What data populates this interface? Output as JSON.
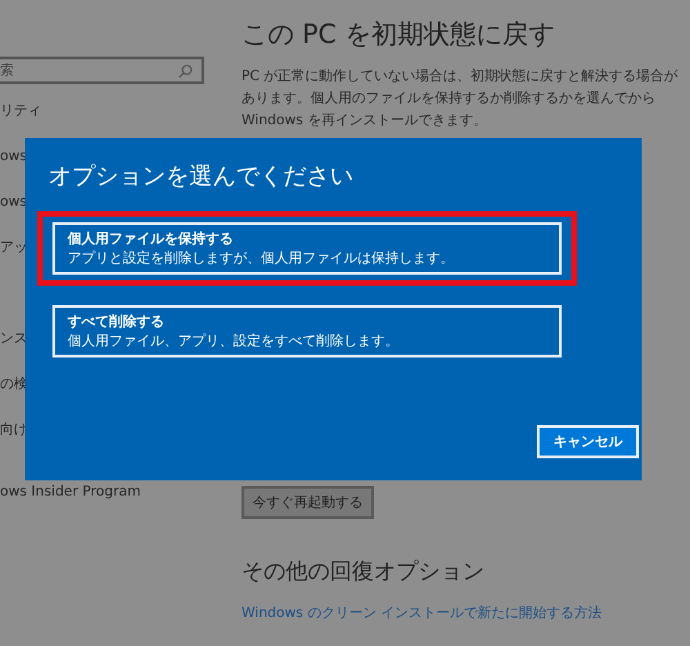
{
  "sidebar": {
    "search": {
      "placeholder": "索"
    },
    "items": [
      "リティ",
      "ows",
      "ows",
      "アッ",
      "ンス",
      "の検",
      "向け",
      "ows Insider Program"
    ]
  },
  "page": {
    "title": "この PC を初期状態に戻す",
    "description": "PC が正常に動作していない場合は、初期状態に戻すと解決する場合があります。個人用のファイルを保持するか削除するかを選んでから Windows を再インストールできます。",
    "restart_button": "今すぐ再起動する",
    "other_title": "その他の回復オプション",
    "link": "Windows のクリーン インストールで新たに開始する方法"
  },
  "dialog": {
    "title": "オプションを選んでください",
    "options": [
      {
        "title": "個人用ファイルを保持する",
        "description": "アプリと設定を削除しますが、個人用ファイルは保持します。",
        "highlighted": true
      },
      {
        "title": "すべて削除する",
        "description": "個人用ファイル、アプリ、設定をすべて削除します。",
        "highlighted": false
      }
    ],
    "cancel_button": "キャンセル"
  }
}
